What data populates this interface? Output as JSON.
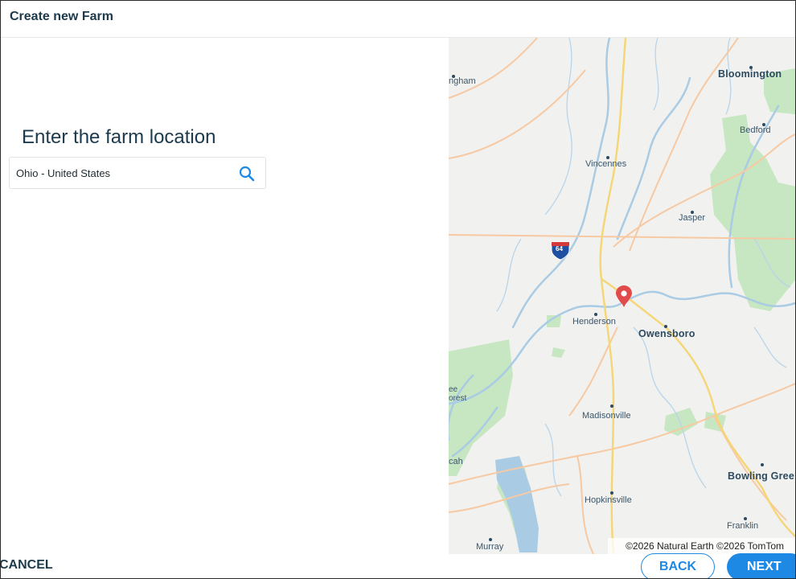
{
  "header": {
    "title": "Create new Farm"
  },
  "form": {
    "heading": "Enter the farm location",
    "search_value": "Ohio - United States"
  },
  "map": {
    "cities": [
      "ngham",
      "Bloomington",
      "Bedford",
      "Vincennes",
      "Jasper",
      "Henderson",
      "Owensboro",
      "ee",
      "orest",
      "Madisonville",
      "cah",
      "Hopkinsville",
      "Bowling Gree",
      "Franklin",
      "Murray"
    ],
    "highway_shield": "64",
    "attribution": "©2026 Natural Earth ©2026 TomTom",
    "colors": {
      "pin": "#e24b4b",
      "water": "#a9cbe4",
      "park": "#c7e6c2",
      "road_major": "#f5d675",
      "road": "#f7c9a3"
    }
  },
  "footer": {
    "cancel_label": "CANCEL",
    "back_label": "BACK",
    "next_label": "NEXT"
  }
}
